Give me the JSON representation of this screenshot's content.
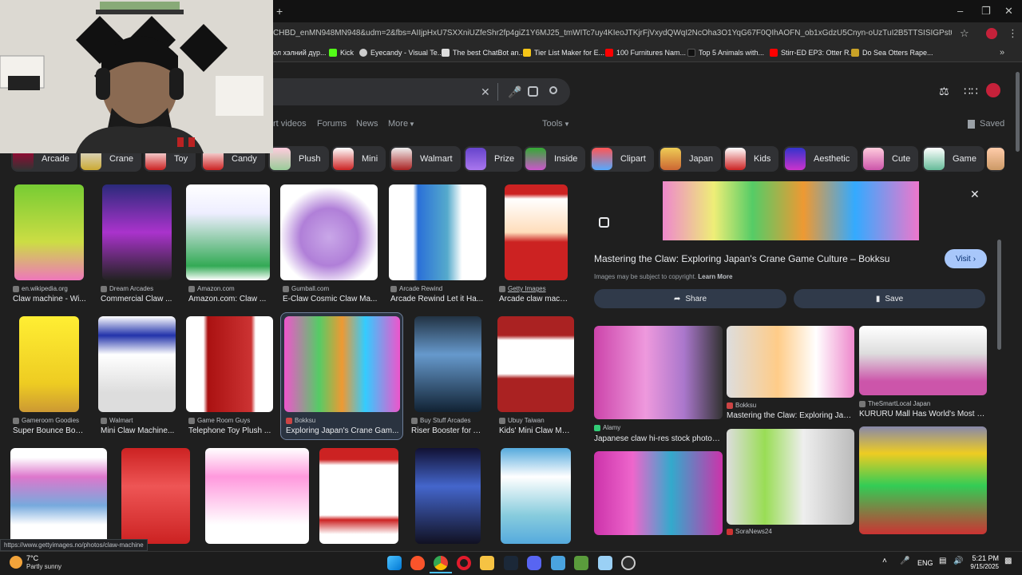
{
  "browser": {
    "new_tab": "+",
    "url": "CHBD_enMN948MN948&udm=2&fbs=AIIjpHxU7SXXniUZfeShr2fp4giZ1Y6MJ25_tmWITc7uy4KIeoJTKjrFjVxydQWqI2NcOha3O1YqG67F0QIhAOFN_ob1xGdzU5Cnyn-oUzTuI2B5TTSISIGPst0CrrCForJ5t1y-1rOb...",
    "bookmarks": [
      "ол хэлний дүр...",
      "Kick",
      "Eyecandy - Visual Te...",
      "The best ChatBot an...",
      "Tier List Maker for E...",
      "100 Furnitures Nam...",
      "Top 5 Animals with...",
      "Stirr-ED EP3: Otter R...",
      "Do Sea Otters Rape..."
    ],
    "bookmark_colors": [
      "#888",
      "#53fc18",
      "#cccccc",
      "#dddddd",
      "#f5c518",
      "#ff0000",
      "#111111",
      "#ff0000",
      "#c9a227"
    ]
  },
  "google": {
    "nav_tabs": [
      "rt videos",
      "Forums",
      "News",
      "More"
    ],
    "tools": "Tools",
    "saved": "Saved",
    "chips": [
      "Arcade",
      "Crane",
      "Toy",
      "Candy",
      "Plush",
      "Mini",
      "Walmart",
      "Prize",
      "Inside",
      "Clipart",
      "Japan",
      "Kids",
      "Aesthetic",
      "Cute",
      "Game"
    ]
  },
  "results": [
    {
      "source": "en.wikipedia.org",
      "title": "Claw machine - Wi..."
    },
    {
      "source": "Dream Arcades",
      "title": "Commercial Claw ..."
    },
    {
      "source": "Amazon.com",
      "title": "Amazon.com: Claw ..."
    },
    {
      "source": "Gumball.com",
      "title": "E-Claw Cosmic Claw Ma..."
    },
    {
      "source": "Arcade Rewind",
      "title": "Arcade Rewind Let it Ha..."
    },
    {
      "source": "Getty Images",
      "title": "Arcade claw machi..."
    },
    {
      "source": "Gameroom Goodies",
      "title": "Super Bounce Bou..."
    },
    {
      "source": "Walmart",
      "title": "Mini Claw Machine..."
    },
    {
      "source": "Game Room Guys",
      "title": "Telephone Toy Plush ..."
    },
    {
      "source": "Bokksu",
      "title": "Exploring Japan's Crane Gam..."
    },
    {
      "source": "Buy Stuff Arcades",
      "title": "Riser Booster for A..."
    },
    {
      "source": "Ubuy Taiwan",
      "title": "Kids' Mini Claw Ma..."
    }
  ],
  "panel": {
    "title": "Mastering the Claw: Exploring Japan's Crane Game Culture – Bokksu",
    "visit": "Visit",
    "copyright": "Images may be subject to copyright.",
    "learn_more": "Learn More",
    "share": "Share",
    "save": "Save",
    "related": [
      {
        "source": "Alamy",
        "title": "Japanese claw hi-res stock photog..."
      },
      {
        "source": "Bokksu",
        "title": "Mastering the Claw: Exploring Jap..."
      },
      {
        "source": "TheSmartLocal Japan",
        "title": "KURURU Mall Has World's Most C..."
      },
      {
        "source": "SoraNews24",
        "title": ""
      }
    ]
  },
  "status_url": "https://www.gettyimages.no/photos/claw-machine",
  "taskbar": {
    "temp": "7°C",
    "weather": "Partly sunny",
    "lang": "ENG",
    "time": "5:21 PM",
    "date": "9/15/2025"
  }
}
